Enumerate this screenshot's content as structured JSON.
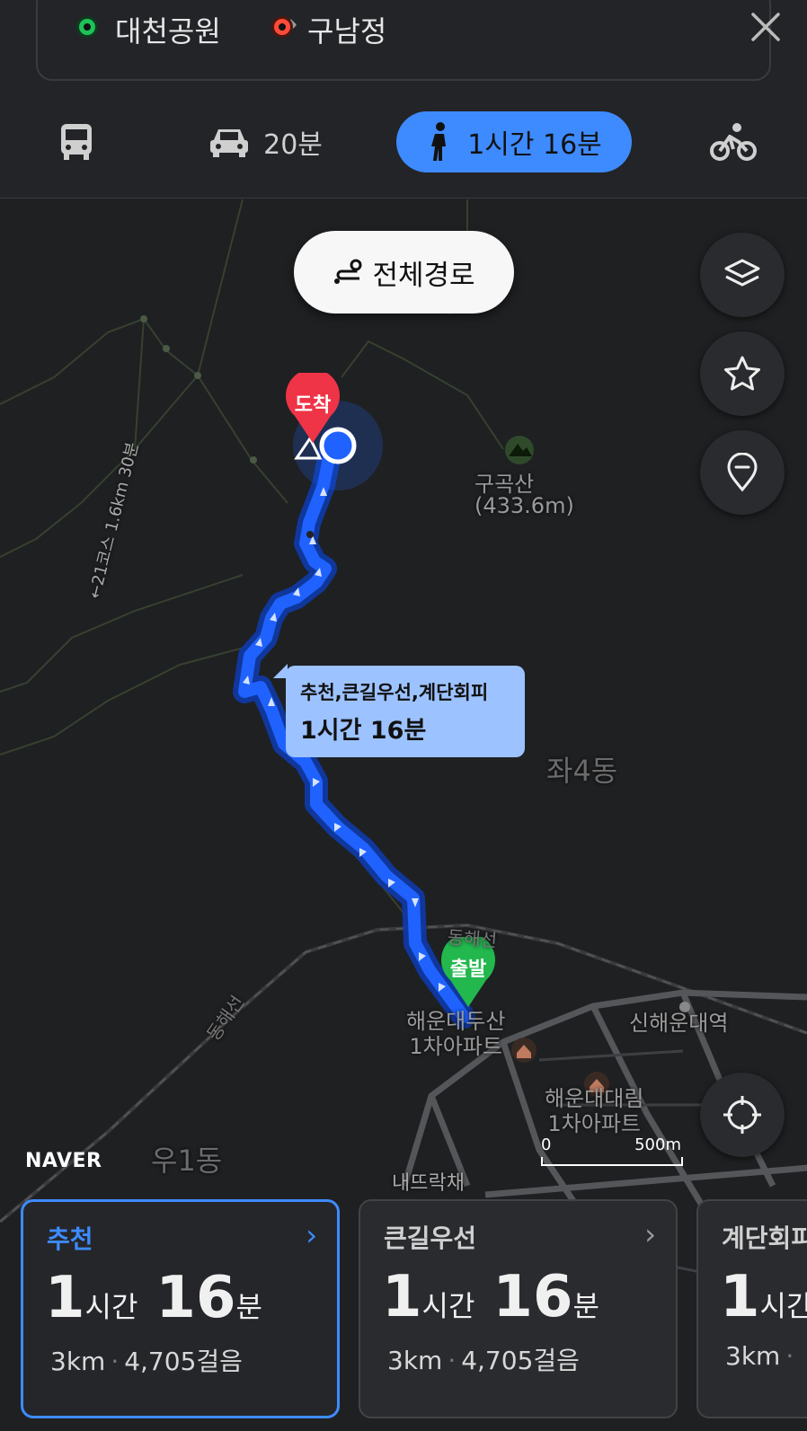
{
  "header": {
    "origin": "대천공원",
    "destination": "구남정",
    "arrow": "→",
    "modes": [
      {
        "name": "bus",
        "icon": "bus-icon",
        "label": ""
      },
      {
        "name": "car",
        "icon": "car-icon",
        "label": "20분"
      },
      {
        "name": "walk",
        "icon": "walk-icon",
        "label": "1시간 16분",
        "active": true
      },
      {
        "name": "bike",
        "icon": "bicycle-icon",
        "label": ""
      }
    ]
  },
  "map": {
    "overview_button": "전체경로",
    "markers": {
      "end": "도착",
      "start": "출발"
    },
    "labels": {
      "mountain": "구곡산",
      "mountain_height": "(433.6m)",
      "district": "좌4동",
      "district2": "우1동",
      "rail": "동해선",
      "rail2": "동해선",
      "station": "신해운대역",
      "apt1_line1": "해운대두산",
      "apt1_line2": "1차아파트",
      "apt2_line1": "해운대대림",
      "apt2_line2": "1차아파트",
      "trail": "←21코스 1.6km 30분",
      "partial_bottom": "내뜨락채"
    },
    "tooltip": {
      "line1": "추천,큰길우선,계단회피",
      "line2": "1시간 16분"
    },
    "scale": {
      "start": "0",
      "end": "500m"
    },
    "logo": "NAVER",
    "accent": "#3d8bff",
    "route_color": "#1a5cff"
  },
  "cards": [
    {
      "label": "추천",
      "hours": "1",
      "hours_unit": "시간",
      "mins": "16",
      "mins_unit": "분",
      "distance": "3km",
      "steps": "4,705걸음",
      "selected": true
    },
    {
      "label": "큰길우선",
      "hours": "1",
      "hours_unit": "시간",
      "mins": "16",
      "mins_unit": "분",
      "distance": "3km",
      "steps": "4,705걸음"
    },
    {
      "label": "계단회피",
      "hours": "1",
      "hours_unit": "시간",
      "mins": "",
      "mins_unit": "",
      "distance": "3km",
      "steps": ""
    }
  ]
}
